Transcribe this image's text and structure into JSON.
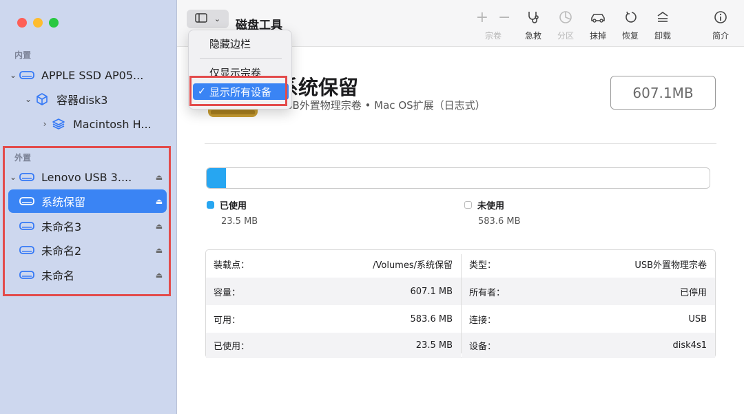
{
  "sidebar": {
    "internal_label": "内置",
    "external_label": "外置",
    "internal_items": [
      {
        "label": "APPLE SSD AP05..."
      },
      {
        "label": "容器disk3"
      },
      {
        "label": "Macintosh H..."
      }
    ],
    "external_items": [
      {
        "label": "Lenovo USB 3...."
      },
      {
        "label": "系统保留",
        "selected": true
      },
      {
        "label": "未命名3"
      },
      {
        "label": "未命名2"
      },
      {
        "label": "未命名"
      }
    ]
  },
  "toolbar": {
    "title": "磁盘工具",
    "buttons": [
      {
        "label": "宗卷",
        "icon": "plus-minus-icon",
        "enabled": false
      },
      {
        "label": "急救",
        "icon": "stethoscope-icon",
        "enabled": true
      },
      {
        "label": "分区",
        "icon": "pie-chart-icon",
        "enabled": false
      },
      {
        "label": "抹掉",
        "icon": "eraser-car-icon",
        "enabled": true
      },
      {
        "label": "恢复",
        "icon": "restore-icon",
        "enabled": true
      },
      {
        "label": "卸载",
        "icon": "unmount-icon",
        "enabled": true
      },
      {
        "label": "简介",
        "icon": "info-icon",
        "enabled": true
      }
    ]
  },
  "view_menu": {
    "items": [
      {
        "label": "隐藏边栏",
        "checked": false
      },
      {
        "label": "仅显示宗卷",
        "checked": false
      },
      {
        "label": "显示所有设备",
        "checked": true
      }
    ]
  },
  "volume": {
    "name": "系统保留",
    "subtitle": "USB外置物理宗卷 • Mac OS扩展（日志式）",
    "capacity": "607.1MB"
  },
  "usage": {
    "used_fraction": 0.039,
    "used_label": "已使用",
    "used_value": "23.5 MB",
    "free_label": "未使用",
    "free_value": "583.6 MB",
    "used_color": "#27a6f1"
  },
  "info": {
    "left": [
      {
        "key": "装载点：",
        "value": "/Volumes/系统保留"
      },
      {
        "key": "容量：",
        "value": "607.1 MB"
      },
      {
        "key": "可用：",
        "value": "583.6 MB"
      },
      {
        "key": "已使用：",
        "value": "23.5 MB"
      }
    ],
    "right": [
      {
        "key": "类型：",
        "value": "USB外置物理宗卷"
      },
      {
        "key": "所有者：",
        "value": "已停用"
      },
      {
        "key": "连接：",
        "value": "USB"
      },
      {
        "key": "设备：",
        "value": "disk4s1"
      }
    ]
  }
}
